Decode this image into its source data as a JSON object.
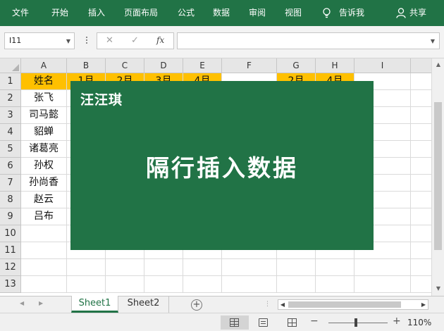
{
  "ribbon": {
    "tabs": [
      "文件",
      "开始",
      "插入",
      "页面布局",
      "公式",
      "数据",
      "审阅",
      "视图"
    ],
    "tell_me": "告诉我",
    "share": "共享",
    "accent": "#217346"
  },
  "formula_bar": {
    "name_box": "I11",
    "fx": "fx",
    "formula": ""
  },
  "grid": {
    "columns": [
      "A",
      "B",
      "C",
      "D",
      "E",
      "F",
      "G",
      "H",
      "I"
    ],
    "rows": [
      "1",
      "2",
      "3",
      "4",
      "5",
      "6",
      "7",
      "8",
      "9",
      "10",
      "11",
      "12",
      "13"
    ],
    "header_row": [
      "姓名",
      "1月",
      "2月",
      "3月",
      "4月",
      "",
      "2月",
      "4月",
      ""
    ],
    "names": [
      "张飞",
      "司马懿",
      "貂蝉",
      "诸葛亮",
      "孙权",
      "孙尚香",
      "赵云",
      "吕布"
    ],
    "header_fill": "#ffc000"
  },
  "banner": {
    "author": "汪汪琪",
    "title": "隔行插入数据",
    "color": "#217346"
  },
  "sheets": [
    "Sheet1",
    "Sheet2"
  ],
  "status": {
    "zoom": "110%",
    "zoom_minus": "−",
    "zoom_plus": "+"
  }
}
